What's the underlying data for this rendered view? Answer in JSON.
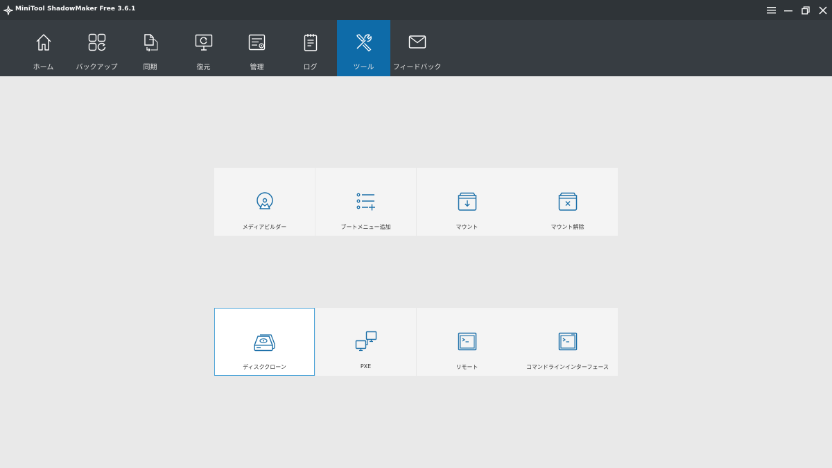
{
  "window": {
    "title": "MiniTool ShadowMaker Free 3.6.1"
  },
  "nav": {
    "items": [
      {
        "label": "ホーム",
        "icon": "home-icon"
      },
      {
        "label": "バックアップ",
        "icon": "backup-icon"
      },
      {
        "label": "同期",
        "icon": "sync-icon"
      },
      {
        "label": "復元",
        "icon": "restore-icon"
      },
      {
        "label": "管理",
        "icon": "manage-icon"
      },
      {
        "label": "ログ",
        "icon": "log-icon"
      },
      {
        "label": "ツール",
        "icon": "tools-icon",
        "active": true
      },
      {
        "label": "フィードバック",
        "icon": "feedback-icon"
      }
    ]
  },
  "tools": {
    "tiles": [
      {
        "label": "メディアビルダー",
        "icon": "media-builder-icon"
      },
      {
        "label": "ブートメニュー追加",
        "icon": "boot-menu-icon"
      },
      {
        "label": "マウント",
        "icon": "mount-icon"
      },
      {
        "label": "マウント解除",
        "icon": "unmount-icon"
      },
      {
        "label": "ディスククローン",
        "icon": "disk-clone-icon",
        "selected": true
      },
      {
        "label": "PXE",
        "icon": "pxe-icon"
      },
      {
        "label": "リモート",
        "icon": "remote-icon"
      },
      {
        "label": "コマンドラインインターフェース",
        "icon": "command-line-icon"
      }
    ]
  },
  "colors": {
    "titlebar": "#2f3438",
    "navbar": "#373d42",
    "accent": "#0e6ba8",
    "icon_blue": "#1b6fa8",
    "background": "#e9e9e9",
    "tile": "#f4f4f4"
  }
}
